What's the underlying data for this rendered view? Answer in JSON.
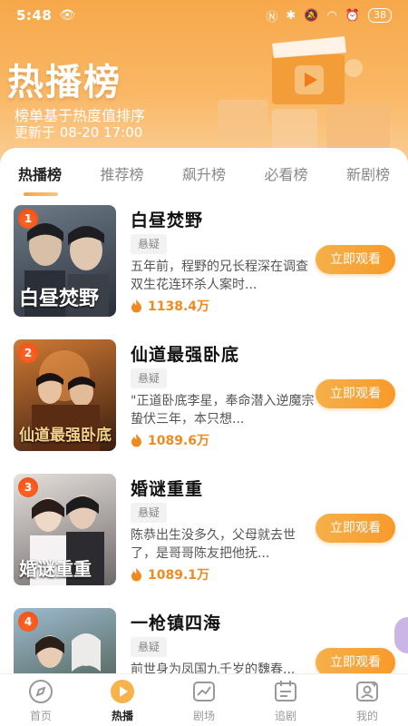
{
  "status_bar": {
    "time": "5:48",
    "battery": "38"
  },
  "header": {
    "title": "热播榜",
    "subtitle": "榜单基于热度值排序",
    "update_text": "更新于 08-20 17:00"
  },
  "tabs": [
    {
      "label": "热播榜",
      "active": true
    },
    {
      "label": "推荐榜",
      "active": false
    },
    {
      "label": "飙升榜",
      "active": false
    },
    {
      "label": "必看榜",
      "active": false
    },
    {
      "label": "新剧榜",
      "active": false
    }
  ],
  "items": [
    {
      "rank": "1",
      "title": "白昼焚野",
      "poster_text": "白昼焚野",
      "tag": "悬疑",
      "desc": "五年前，程野的兄长程深在调查双生花连环杀人案时...",
      "heat": "1138.4万",
      "button": "立即观看",
      "poster_colors": [
        "#5b6a78",
        "#2a2f3a"
      ]
    },
    {
      "rank": "2",
      "title": "仙道最强卧底",
      "poster_text": "仙道最强卧底",
      "tag": "悬疑",
      "desc": "\"正道卧底李星，奉命潜入逆魔宗蛰伏三年，本只想...",
      "heat": "1089.6万",
      "button": "立即观看",
      "poster_colors": [
        "#c56a2a",
        "#3a1d10"
      ]
    },
    {
      "rank": "3",
      "title": "婚谜重重",
      "poster_text": "婚谜重重",
      "tag": "悬疑",
      "desc": "陈恭出生没多久，父母就去世了，是哥哥陈友把他抚...",
      "heat": "1089.1万",
      "button": "立即观看",
      "poster_colors": [
        "#d9d3cf",
        "#6f6a6a"
      ]
    },
    {
      "rank": "4",
      "title": "一枪镇四海",
      "poster_text": "",
      "tag": "悬疑",
      "desc": "前世身为凤国九千岁的魏春...",
      "heat": "",
      "button": "立即观看",
      "poster_colors": [
        "#8fb0c8",
        "#3e4f3a"
      ]
    }
  ],
  "bottom_nav": [
    {
      "label": "首页",
      "icon": "compass-icon",
      "active": false
    },
    {
      "label": "热播",
      "icon": "play-icon",
      "active": true
    },
    {
      "label": "剧场",
      "icon": "chart-icon",
      "active": false
    },
    {
      "label": "追剧",
      "icon": "calendar-icon",
      "active": false
    },
    {
      "label": "我的",
      "icon": "profile-icon",
      "active": false
    }
  ],
  "colors": {
    "accent": "#f5a23c",
    "heat": "#f08a1e",
    "rank_badge": "#f04a10"
  }
}
